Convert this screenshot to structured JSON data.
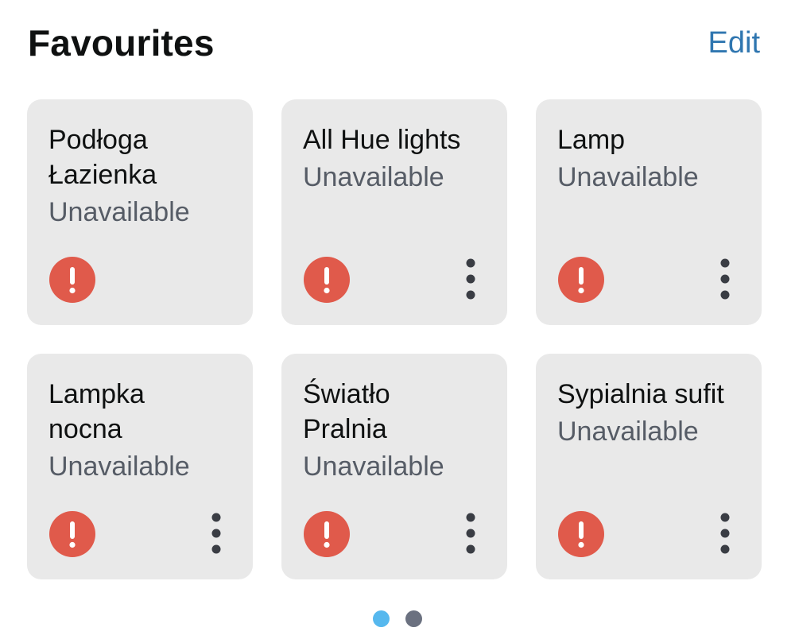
{
  "header": {
    "title": "Favourites",
    "edit_label": "Edit"
  },
  "devices": [
    {
      "name_lines": [
        "Podłoga",
        "Łazienka"
      ],
      "status": "Unavailable",
      "alert_icon": "exclamation-circle-icon",
      "has_menu": false
    },
    {
      "name_lines": [
        "All Hue lights"
      ],
      "status": "Unavailable",
      "alert_icon": "exclamation-circle-icon",
      "has_menu": true
    },
    {
      "name_lines": [
        "Lamp"
      ],
      "status": "Unavailable",
      "alert_icon": "exclamation-circle-icon",
      "has_menu": true
    },
    {
      "name_lines": [
        "Lampka",
        "nocna"
      ],
      "status": "Unavailable",
      "alert_icon": "exclamation-circle-icon",
      "has_menu": true
    },
    {
      "name_lines": [
        "Światło",
        "Pralnia"
      ],
      "status": "Unavailable",
      "alert_icon": "exclamation-circle-icon",
      "has_menu": true
    },
    {
      "name_lines": [
        "Sypialnia sufit"
      ],
      "status": "Unavailable",
      "alert_icon": "exclamation-circle-icon",
      "has_menu": true
    }
  ],
  "pagination": {
    "pages": 2,
    "current_page": 1
  },
  "colors": {
    "accent_link": "#2f76b0",
    "card_background": "#e9e9e9",
    "alert": "#e05a4b",
    "active_dot": "#56b8ee",
    "inactive_dot": "#6b7180",
    "status_text": "#565c66"
  }
}
